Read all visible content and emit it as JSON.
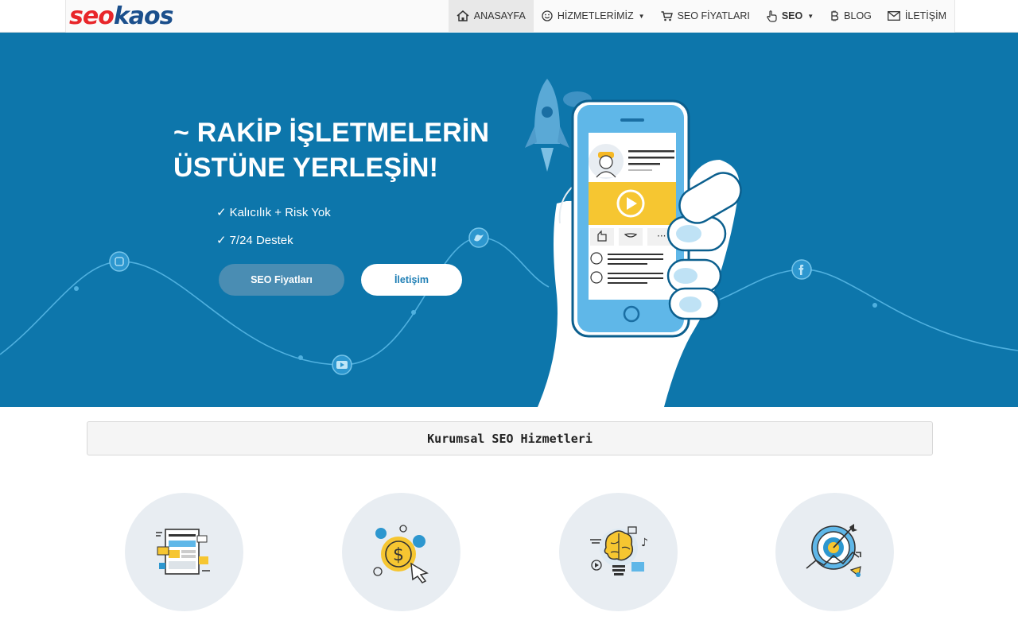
{
  "brand": {
    "logo_part1": "seo",
    "logo_part2": "kaos"
  },
  "nav": {
    "items": [
      {
        "label": "ANASAYFA",
        "icon": "home-icon",
        "active": true
      },
      {
        "label": "HİZMETLERİMİZ",
        "icon": "smiley-icon",
        "dropdown": true
      },
      {
        "label": "SEO FİYATLARI",
        "icon": "cart-icon"
      },
      {
        "label": "SEO",
        "icon": "hand-pointer-icon",
        "dropdown": true
      },
      {
        "label": "BLOG",
        "icon": "bitcoin-icon"
      },
      {
        "label": "İLETİŞİM",
        "icon": "envelope-icon"
      }
    ]
  },
  "hero": {
    "title_line1": "~ RAKİP İŞLETMELERİN",
    "title_line2": "ÜSTÜNE YERLEŞİN!",
    "features": [
      "Kalıcılık + Risk Yok",
      "7/24 Destek"
    ],
    "check_mark": "✓",
    "buttons": {
      "seo_prices": "SEO Fiyatları",
      "contact": "İletişim"
    }
  },
  "section": {
    "title": "Kurumsal SEO Hizmetleri"
  },
  "services": [
    {
      "icon": "web-design-icon"
    },
    {
      "icon": "dollar-coin-click-icon"
    },
    {
      "icon": "brain-idea-icon"
    },
    {
      "icon": "target-growth-icon"
    }
  ],
  "colors": {
    "hero_bg": "#0d76ab",
    "logo_red": "#e8262a",
    "logo_blue": "#1b4f8c",
    "circle_bg": "#e8edf2"
  }
}
